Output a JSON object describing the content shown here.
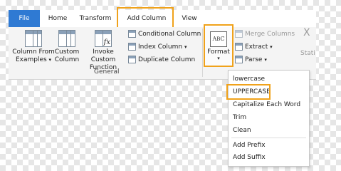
{
  "tabs": {
    "file": "File",
    "home": "Home",
    "transform": "Transform",
    "add_column": "Add Column",
    "view": "View"
  },
  "ribbon": {
    "column_from_examples": [
      "Column From",
      "Examples"
    ],
    "custom_column": [
      "Custom",
      "Column"
    ],
    "invoke_custom_function": [
      "Invoke Custom",
      "Function"
    ],
    "conditional_column": "Conditional Column",
    "index_column": "Index Column",
    "duplicate_column": "Duplicate Column",
    "general_group": "General",
    "format": "Format",
    "merge_columns": "Merge Columns",
    "extract": "Extract",
    "parse": "Parse",
    "stats_partial": "Stati",
    "x_partial": "X"
  },
  "format_menu": {
    "items": [
      "lowercase",
      "UPPERCASE",
      "Capitalize Each Word",
      "Trim",
      "Clean",
      "Add Prefix",
      "Add Suffix"
    ]
  },
  "colors": {
    "file_tab": "#2f7ad3",
    "highlight": "#f0a21b",
    "ribbon_bg": "#f4f4f4"
  },
  "icons": {
    "dropdown": "▾"
  }
}
